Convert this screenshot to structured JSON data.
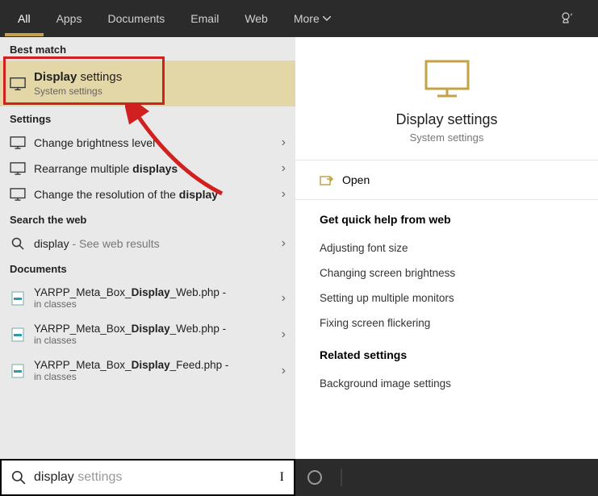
{
  "nav": {
    "tabs": [
      "All",
      "Apps",
      "Documents",
      "Email",
      "Web",
      "More"
    ]
  },
  "left": {
    "best_label": "Best match",
    "best": {
      "title_prefix": "Display",
      "title_rest": " settings",
      "sub": "System settings"
    },
    "settings_label": "Settings",
    "settings": [
      "Change brightness level",
      "Rearrange multiple ",
      "Change the resolution of the "
    ],
    "settings_bold": [
      "",
      "displays",
      "display"
    ],
    "web_label": "Search the web",
    "web_item": "display",
    "web_suffix": " - See web results",
    "docs_label": "Documents",
    "docs": [
      {
        "name_a": "YARPP_Meta_Box_",
        "name_b": "Display",
        "name_c": "_Web.php -",
        "sub": "in classes"
      },
      {
        "name_a": "YARPP_Meta_Box_",
        "name_b": "Display",
        "name_c": "_Web.php -",
        "sub": "in classes"
      },
      {
        "name_a": "YARPP_Meta_Box_",
        "name_b": "Display",
        "name_c": "_Feed.php -",
        "sub": "in classes"
      }
    ]
  },
  "right": {
    "title": "Display settings",
    "sub": "System settings",
    "open": "Open",
    "quick_label": "Get quick help from web",
    "quick": [
      "Adjusting font size",
      "Changing screen brightness",
      "Setting up multiple monitors",
      "Fixing screen flickering"
    ],
    "related_label": "Related settings",
    "related": [
      "Background image settings"
    ]
  },
  "search": {
    "typed": "display",
    "ghost": " settings"
  }
}
